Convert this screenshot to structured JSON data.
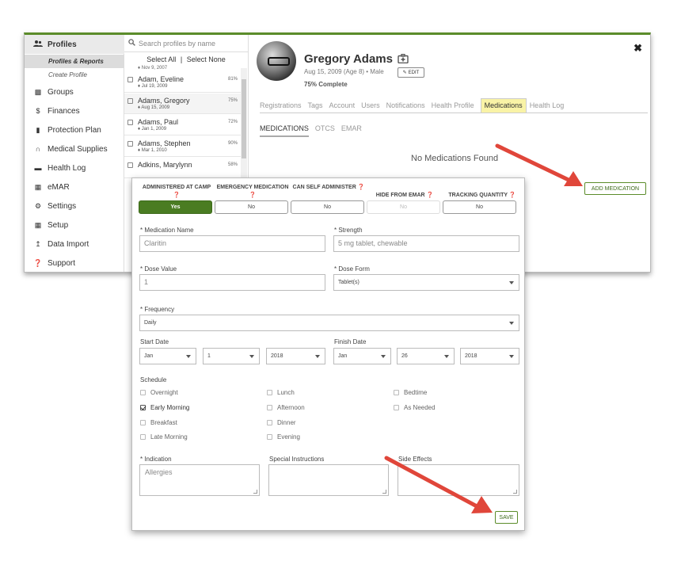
{
  "nav": {
    "profiles": "Profiles",
    "profiles_reports": "Profiles & Reports",
    "create_profile": "Create Profile",
    "items": [
      "Groups",
      "Finances",
      "Protection Plan",
      "Medical Supplies",
      "Health Log",
      "eMAR",
      "Settings",
      "Setup",
      "Data Import",
      "Support"
    ]
  },
  "list": {
    "search_placeholder": "Search profiles by name",
    "select_all": "Select All",
    "sep": "|",
    "select_none": "Select None",
    "partial_date": "Nov 9, 2007",
    "rows": [
      {
        "name": "Adam, Eveline",
        "date": "Jul 19, 2009",
        "pct": "81%"
      },
      {
        "name": "Adams, Gregory",
        "date": "Aug 15, 2009",
        "pct": "75%"
      },
      {
        "name": "Adams, Paul",
        "date": "Jan 1, 2009",
        "pct": "72%"
      },
      {
        "name": "Adams, Stephen",
        "date": "Mar 1, 2010",
        "pct": "90%"
      },
      {
        "name": "Adkins, Marylynn",
        "date": "",
        "pct": "58%"
      }
    ]
  },
  "profile": {
    "name": "Gregory Adams",
    "meta": "Aug 15, 2009 (Age 8) • Male",
    "edit": "EDIT",
    "complete": "75% Complete"
  },
  "tabs": [
    "Registrations",
    "Tags",
    "Account",
    "Users",
    "Notifications",
    "Health Profile",
    "Medications",
    "Health Log"
  ],
  "subtabs": [
    "MEDICATIONS",
    "OTCS",
    "EMAR"
  ],
  "no_meds": "No Medications Found",
  "add_medication": "ADD MEDICATION",
  "modal": {
    "toggles": [
      {
        "label": "ADMINISTERED AT CAMP",
        "value": "Yes"
      },
      {
        "label": "EMERGENCY MEDICATION",
        "value": "No"
      },
      {
        "label": "CAN SELF ADMINISTER",
        "value": "No"
      },
      {
        "label": "HIDE FROM EMAR",
        "value": "No"
      },
      {
        "label": "TRACKING QUANTITY",
        "value": "No"
      }
    ],
    "med_name_label": "* Medication Name",
    "med_name_value": "Claritin",
    "strength_label": "* Strength",
    "strength_value": "5 mg tablet, chewable",
    "dose_value_label": "* Dose Value",
    "dose_value": "1",
    "dose_form_label": "* Dose Form",
    "dose_form": "Tablet(s)",
    "frequency_label": "* Frequency",
    "frequency": "Daily",
    "start_label": "Start Date",
    "start_month": "Jan",
    "start_day": "1",
    "start_year": "2018",
    "finish_label": "Finish Date",
    "finish_month": "Jan",
    "finish_day": "26",
    "finish_year": "2018",
    "schedule_label": "Schedule",
    "schedule": [
      "Overnight",
      "Early Morning",
      "Breakfast",
      "Late Morning",
      "Lunch",
      "Afternoon",
      "Dinner",
      "Evening",
      "Bedtime",
      "As Needed"
    ],
    "indication_label": "* Indication",
    "indication_value": "Allergies",
    "special_label": "Special Instructions",
    "side_label": "Side Effects",
    "save": "SAVE"
  },
  "colors": {
    "accent": "#4a7c22",
    "tab_highlight": "#f9f3a6",
    "arrow": "#e0463a"
  }
}
